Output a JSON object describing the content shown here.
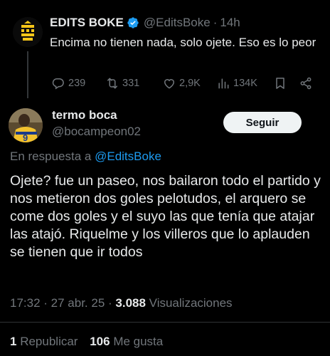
{
  "parent_tweet": {
    "author_name": "EDITS BOKE",
    "handle": "@EditsBoke",
    "separator": "·",
    "time": "14h",
    "text": "Encima no tienen nada, solo ojete. Eso es lo peor",
    "actions": {
      "replies": "239",
      "reposts": "331",
      "likes": "2,9K",
      "views": "134K"
    }
  },
  "main_tweet": {
    "author_name": "termo boca",
    "handle": "@bocampeon02",
    "follow_label": "Seguir",
    "reply_prefix": "En respuesta a",
    "reply_mention": "@EditsBoke",
    "text": "Ojete? fue un paseo, nos bailaron todo el partido y nos metieron dos goles pelotudos, el arquero se come dos goles y el suyo las que tenía que atajar las atajó. Riquelme y los villeros que lo aplauden se tienen que ir todos",
    "timestamp": "17:32 · 27 abr. 25 · ",
    "views_count": "3.088",
    "views_label": "Visualizaciones",
    "reposts_count": "1",
    "reposts_label": "Republicar",
    "likes_count": "106",
    "likes_label": "Me gusta"
  },
  "colors": {
    "background": "#000000",
    "text": "#e7e9ea",
    "muted": "#71767b",
    "link": "#1d9bf0",
    "brand_yellow": "#f5c518",
    "verified_blue": "#1d9bf0"
  },
  "icons": [
    "reply-icon",
    "repost-icon",
    "like-icon",
    "views-icon",
    "bookmark-icon",
    "share-icon",
    "verified-badge-icon"
  ]
}
